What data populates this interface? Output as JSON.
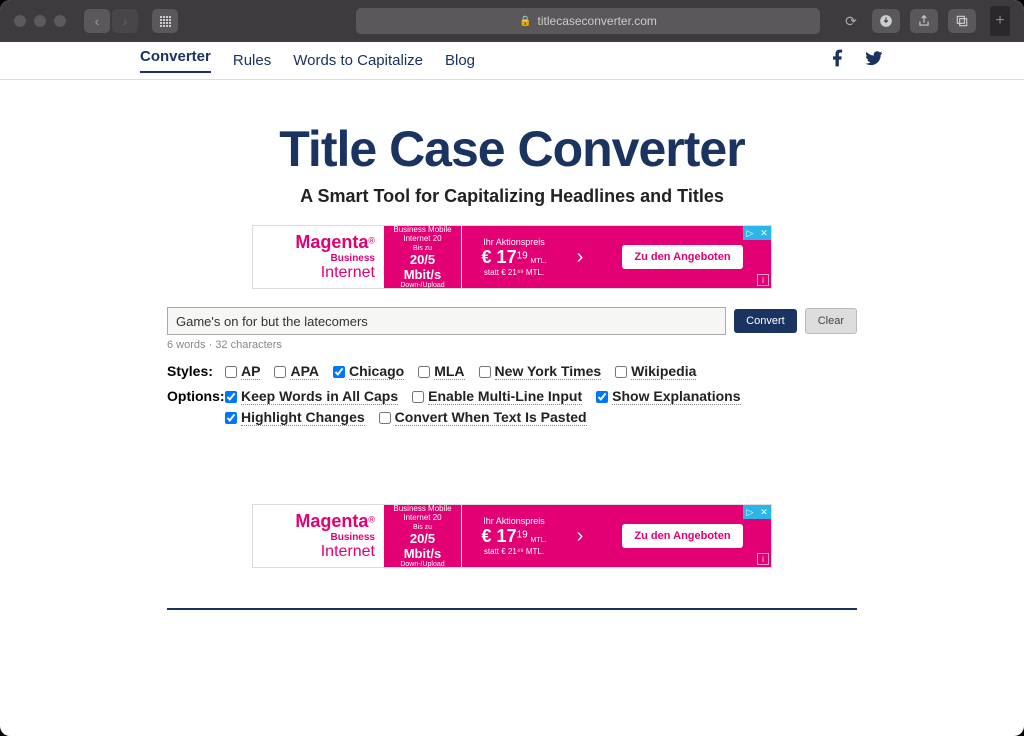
{
  "browser": {
    "url": "titlecaseconverter.com"
  },
  "nav": {
    "converter": "Converter",
    "rules": "Rules",
    "words": "Words to Capitalize",
    "blog": "Blog"
  },
  "hero": {
    "title": "Title Case Converter",
    "subtitle": "A Smart Tool for Capitalizing Headlines and Titles"
  },
  "ad": {
    "brand": "Magenta",
    "business": "Business",
    "internet": "Internet",
    "box1_line1": "Business Mobile",
    "box1_line2": "Internet 20",
    "box1_line3": "Bis zu",
    "box1_speed": "20/5 Mbit/s",
    "box1_line5": "Down-/Upload",
    "box2_line1": "Ihr Aktionspreis",
    "box2_price": "€ 17",
    "box2_cents": "19",
    "box2_mtl": "MTL.",
    "box2_line3": "statt € 21⁴⁹ MTL.",
    "cta": "Zu den Angeboten"
  },
  "converter": {
    "input_value": "Game's on for but the latecomers",
    "count": "6 words · 32 characters",
    "convert": "Convert",
    "clear": "Clear"
  },
  "styles": {
    "label": "Styles:",
    "ap": "AP",
    "apa": "APA",
    "chicago": "Chicago",
    "mla": "MLA",
    "nyt": "New York Times",
    "wikipedia": "Wikipedia"
  },
  "options": {
    "label": "Options:",
    "keep_caps": "Keep Words in All Caps",
    "multiline": "Enable Multi-Line Input",
    "explanations": "Show Explanations",
    "highlight": "Highlight Changes",
    "convert_paste": "Convert When Text Is Pasted"
  }
}
